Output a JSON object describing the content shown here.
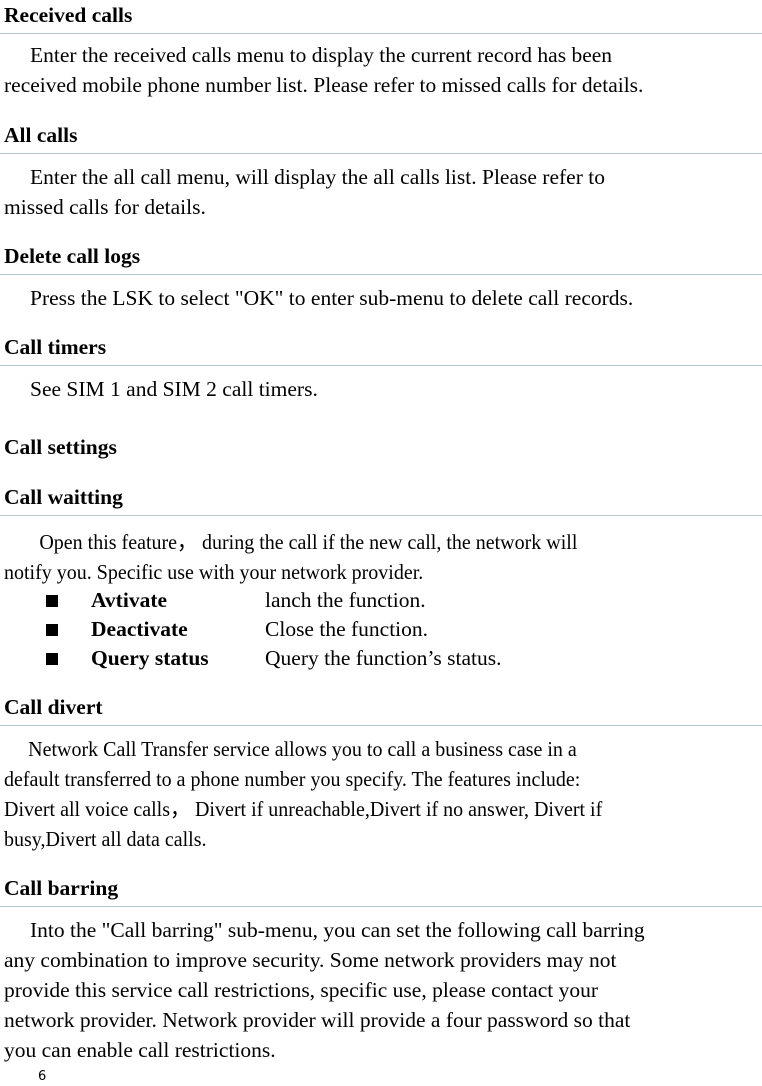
{
  "sections": {
    "received_calls": {
      "title": "Received calls",
      "lines": [
        "Enter the received calls menu to display the current record has been",
        "received mobile phone number list. Please refer to missed calls for details."
      ]
    },
    "all_calls": {
      "title": "All calls",
      "lines": [
        "Enter the all call menu, will display the all calls list. Please refer to",
        "missed calls for details."
      ]
    },
    "delete_call_logs": {
      "title": "Delete call logs",
      "lines": [
        "Press the LSK to select \"OK\" to enter sub-menu to delete call records."
      ]
    },
    "call_timers": {
      "title": "Call timers",
      "lines": [
        "See SIM 1 and SIM 2 call timers."
      ]
    },
    "call_settings": {
      "title": "Call settings"
    },
    "call_waiting": {
      "title": "Call waitting",
      "lines": [
        "Open this feature， during the call if the new call, the network will",
        "notify you. Specific use with your network provider."
      ],
      "options": [
        {
          "term": "Avtivate",
          "desc": "lanch the function."
        },
        {
          "term": "Deactivate",
          "desc": "Close the function."
        },
        {
          "term": "Query status",
          "desc": "Query the function’s status."
        }
      ]
    },
    "call_divert": {
      "title": "Call divert",
      "lines": [
        "Network Call Transfer service allows you to call a business case in a",
        "default transferred to a phone number you specify. The features include:",
        "Divert all voice calls， Divert if unreachable,Divert if no answer, Divert if",
        "busy,Divert all data calls."
      ]
    },
    "call_barring": {
      "title": "Call barring",
      "lines": [
        "Into the \"Call barring\" sub-menu, you can set the following call barring",
        "any combination to improve security. Some network providers may not",
        "provide this service call restrictions, specific use, please contact your",
        "network provider. Network provider will provide a four password so that",
        "you can enable call restrictions."
      ]
    }
  },
  "footer": {
    "page_number": "6"
  }
}
